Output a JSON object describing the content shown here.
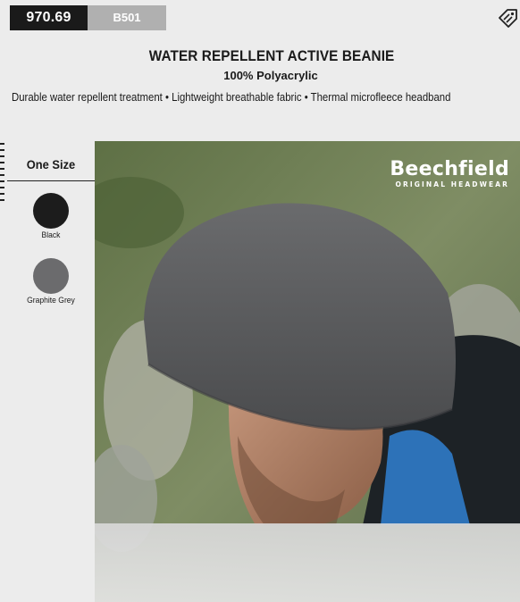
{
  "header": {
    "price": "970.69",
    "code": "B501",
    "tag_icon": "price-tag-icon"
  },
  "product": {
    "title": "WATER REPELLENT ACTIVE BEANIE",
    "material": "100% Polyacrylic",
    "features": "Durable water repellent treatment • Lightweight breathable fabric • Thermal microfleece headband"
  },
  "sizes": {
    "heading": "One Size"
  },
  "colours": [
    {
      "name": "Black",
      "hex": "#1c1c1c"
    },
    {
      "name": "Graphite Grey",
      "hex": "#6b6b6d"
    }
  ],
  "brand": {
    "name": "Beechfield",
    "tagline": "ORIGINAL HEADWEAR"
  }
}
